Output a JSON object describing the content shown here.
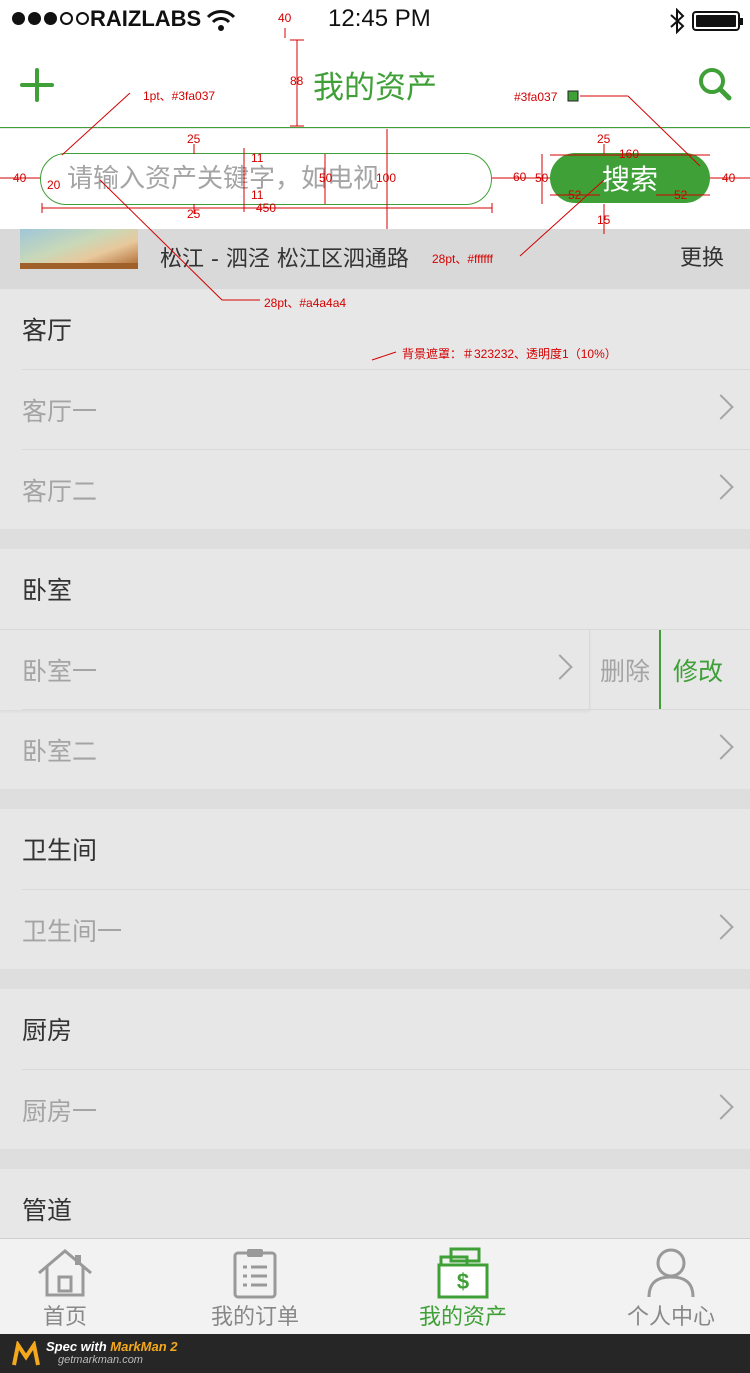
{
  "statusbar": {
    "carrier": "RAIZLABS",
    "time": "12:45 PM"
  },
  "navbar": {
    "title": "我的资产",
    "add_icon": "plus-icon",
    "search_icon": "search-icon"
  },
  "search": {
    "placeholder": "请输入资产关键字，如电视",
    "button_label": "搜索"
  },
  "location": {
    "address": "松江 - 泗泾 松江区泗通路",
    "change_label": "更换"
  },
  "groups": [
    {
      "title": "客厅",
      "items": [
        "客厅一",
        "客厅二"
      ]
    },
    {
      "title": "卧室",
      "items": [
        "卧室一",
        "卧室二"
      ],
      "swiped_index": 0,
      "swipe_actions": {
        "delete": "删除",
        "edit": "修改"
      }
    },
    {
      "title": "卫生间",
      "items": [
        "卫生间一"
      ]
    },
    {
      "title": "厨房",
      "items": [
        "厨房一"
      ]
    },
    {
      "title": "管道",
      "items": []
    }
  ],
  "tabbar": [
    {
      "label": "首页",
      "icon": "home-icon",
      "active": false
    },
    {
      "label": "我的订单",
      "icon": "clipboard-icon",
      "active": false
    },
    {
      "label": "我的资产",
      "icon": "assets-icon",
      "active": true
    },
    {
      "label": "个人中心",
      "icon": "person-icon",
      "active": false
    }
  ],
  "footer": {
    "brand_prefix": "Spec with ",
    "brand_name": "MarkMan 2",
    "site": "getmarkman.com"
  },
  "annotations": {
    "a40": "40",
    "a88": "88",
    "line_note": "1pt、#3fa037",
    "color_swatch": "#3fa037",
    "a25_top": "25",
    "a25_right": "25",
    "a160": "160",
    "a11_top": "11",
    "a11_bottom": "11",
    "a40_left": "40",
    "a20": "20",
    "a50_mid": "50",
    "a100": "100",
    "a60": "60",
    "a50_right": "50",
    "a52_left": "52",
    "a52_right": "52",
    "a40_right": "40",
    "a25_bottom": "25",
    "a450": "450",
    "a15": "15",
    "text_white": "28pt、#ffffff",
    "text_gray": "28pt、#a4a4a4",
    "mask_note": "背景遮罩：＃323232、透明度1（10%）"
  },
  "colors": {
    "accent": "#3fa037",
    "placeholder": "#a4a4a4",
    "mask": "#323232"
  }
}
